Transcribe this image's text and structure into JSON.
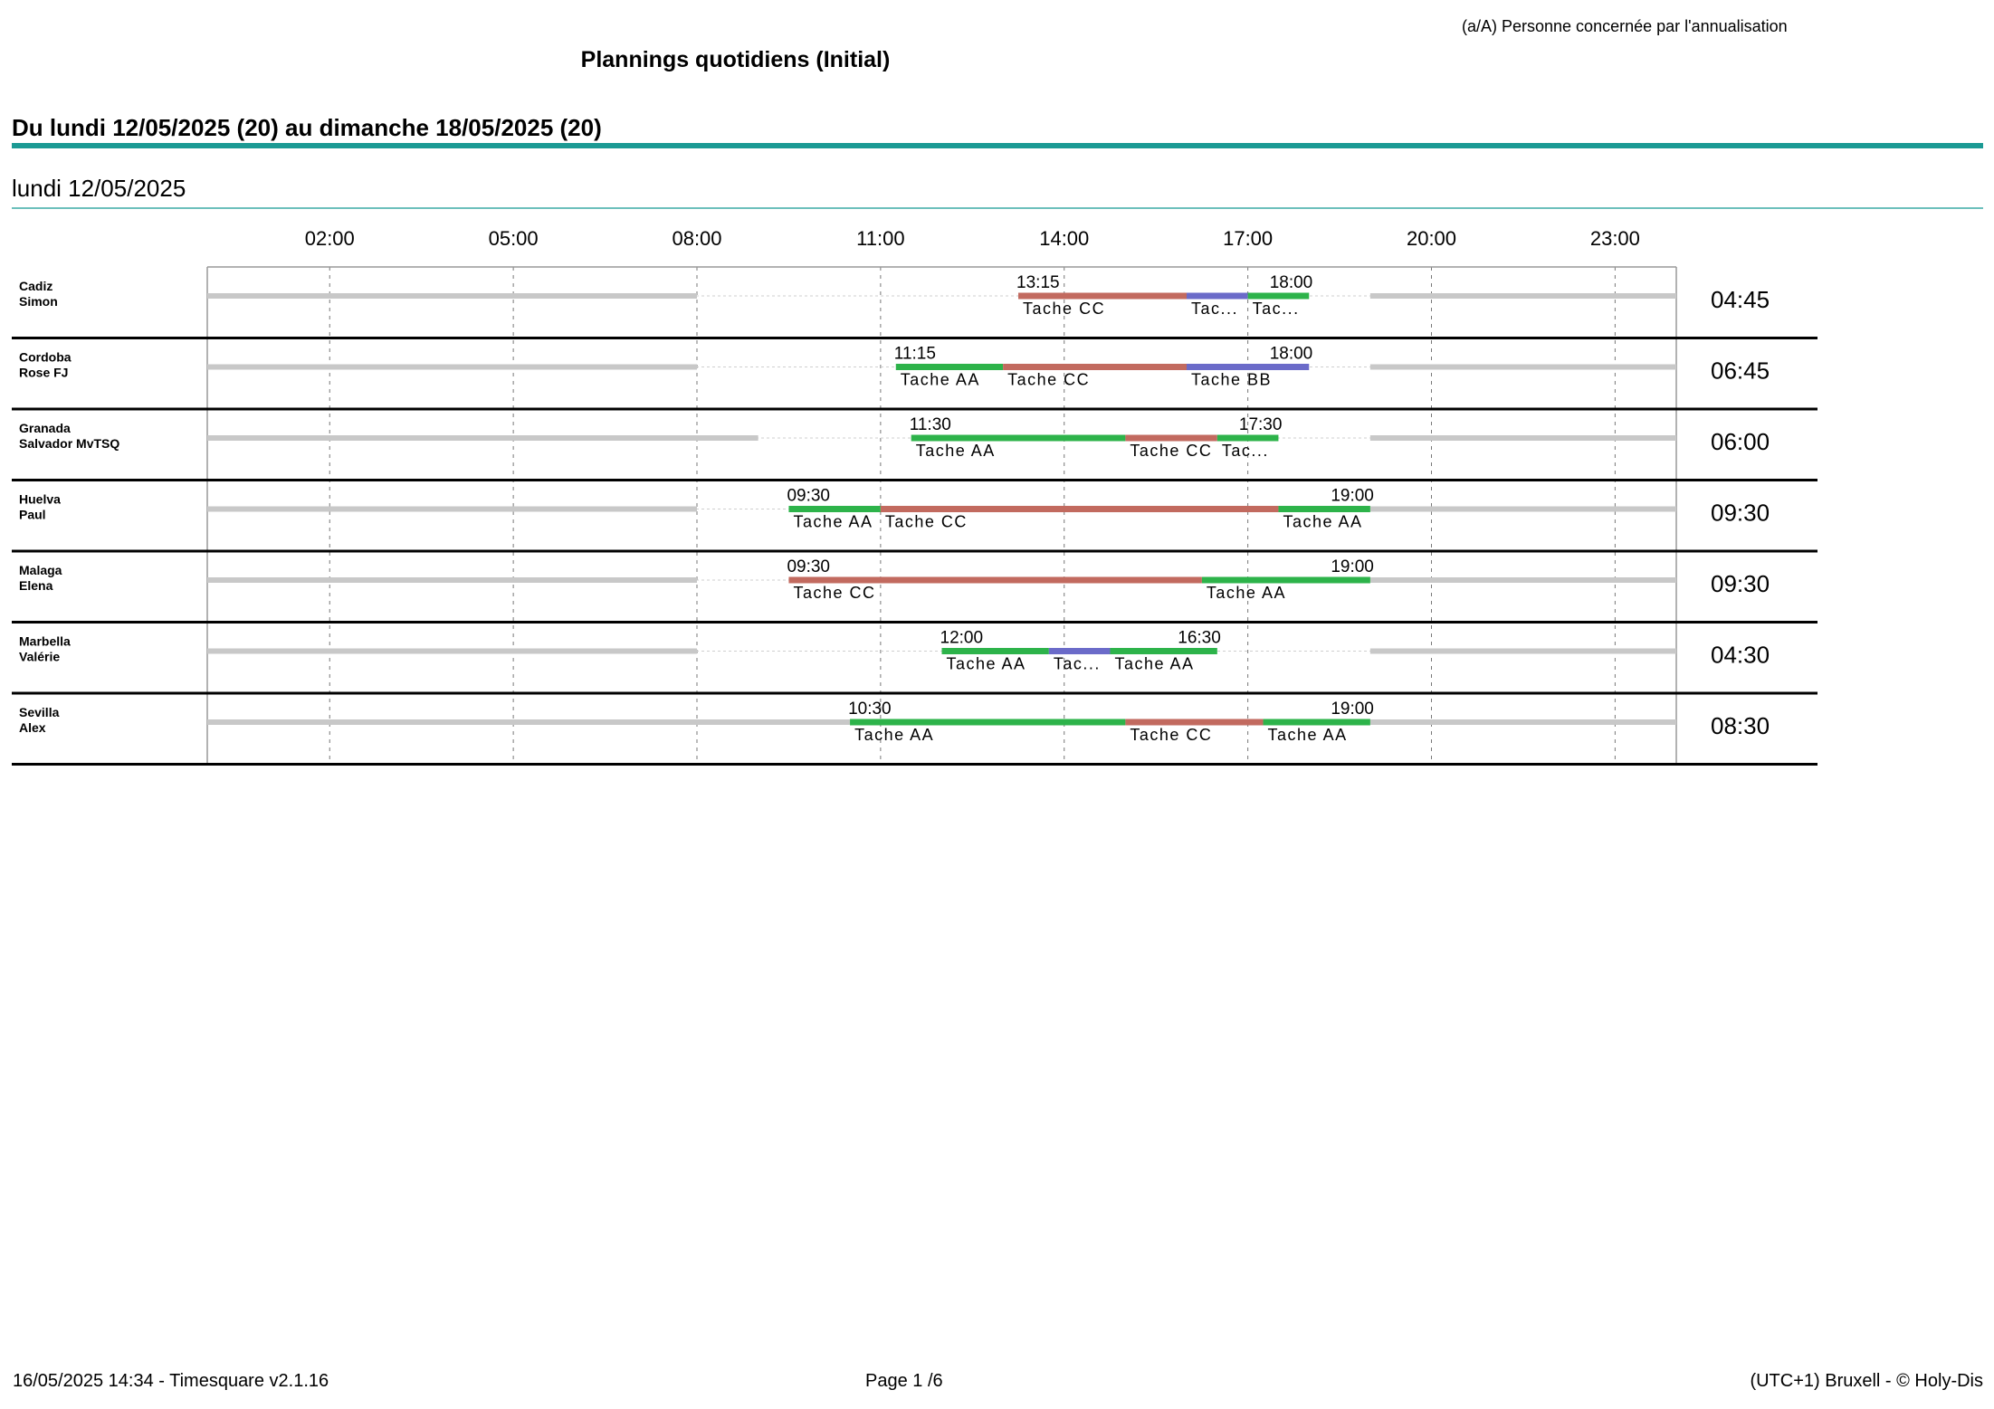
{
  "header": {
    "legend_note": "(a/A) Personne concernée par l'annualisation",
    "title": "Plannings quotidiens (Initial)",
    "week": "Du lundi 12/05/2025 (20) au dimanche 18/05/2025 (20)",
    "day": "lundi 12/05/2025"
  },
  "colors": {
    "accent_rule": "#1b9a94",
    "day_rule": "#6cc0bc",
    "off_bar": "#c8c8c8",
    "Tache AA": "#2db34a",
    "Tache CC": "#c26a5f",
    "Tache BB": "#6b6bc9"
  },
  "hour_ticks": [
    "02:00",
    "05:00",
    "08:00",
    "11:00",
    "14:00",
    "17:00",
    "20:00",
    "23:00"
  ],
  "rows": [
    {
      "name_line1": "Cadiz",
      "name_line2": "Simon",
      "start_label": "13:15",
      "end_label": "18:00",
      "total": "04:45",
      "unavailable": [
        [
          0,
          8
        ],
        [
          19,
          24
        ]
      ],
      "segments": [
        {
          "start": 13.25,
          "end": 16.0,
          "task": "Tache CC",
          "label": "Tache CC"
        },
        {
          "start": 16.0,
          "end": 17.0,
          "task": "Tache BB",
          "label": "Tac..."
        },
        {
          "start": 17.0,
          "end": 18.0,
          "task": "Tache AA",
          "label": "Tac..."
        }
      ]
    },
    {
      "name_line1": "Cordoba",
      "name_line2": "Rose FJ",
      "start_label": "11:15",
      "end_label": "18:00",
      "total": "06:45",
      "unavailable": [
        [
          0,
          8
        ],
        [
          19,
          24
        ]
      ],
      "segments": [
        {
          "start": 11.25,
          "end": 13.0,
          "task": "Tache AA",
          "label": "Tache AA"
        },
        {
          "start": 13.0,
          "end": 16.0,
          "task": "Tache CC",
          "label": "Tache CC"
        },
        {
          "start": 16.0,
          "end": 18.0,
          "task": "Tache BB",
          "label": "Tache BB"
        }
      ]
    },
    {
      "name_line1": "Granada",
      "name_line2": "Salvador MvTSQ",
      "start_label": "11:30",
      "end_label": "17:30",
      "total": "06:00",
      "unavailable": [
        [
          0,
          9
        ],
        [
          19,
          24
        ]
      ],
      "segments": [
        {
          "start": 11.5,
          "end": 15.0,
          "task": "Tache AA",
          "label": "Tache AA"
        },
        {
          "start": 15.0,
          "end": 16.5,
          "task": "Tache CC",
          "label": "Tache CC"
        },
        {
          "start": 16.5,
          "end": 17.5,
          "task": "Tache AA",
          "label": "Tac..."
        }
      ]
    },
    {
      "name_line1": "Huelva",
      "name_line2": "Paul",
      "start_label": "09:30",
      "end_label": "19:00",
      "total": "09:30",
      "unavailable": [
        [
          0,
          8
        ],
        [
          19,
          24
        ]
      ],
      "segments": [
        {
          "start": 9.5,
          "end": 11.0,
          "task": "Tache AA",
          "label": "Tache AA"
        },
        {
          "start": 11.0,
          "end": 17.5,
          "task": "Tache CC",
          "label": "Tache CC"
        },
        {
          "start": 17.5,
          "end": 19.0,
          "task": "Tache AA",
          "label": "Tache AA"
        }
      ]
    },
    {
      "name_line1": "Malaga",
      "name_line2": "Elena",
      "start_label": "09:30",
      "end_label": "19:00",
      "total": "09:30",
      "unavailable": [
        [
          0,
          8
        ],
        [
          19,
          24
        ]
      ],
      "segments": [
        {
          "start": 9.5,
          "end": 16.25,
          "task": "Tache CC",
          "label": "Tache CC"
        },
        {
          "start": 16.25,
          "end": 19.0,
          "task": "Tache AA",
          "label": "Tache AA"
        }
      ]
    },
    {
      "name_line1": "Marbella",
      "name_line2": "Valérie",
      "start_label": "12:00",
      "end_label": "16:30",
      "total": "04:30",
      "unavailable": [
        [
          0,
          8
        ],
        [
          19,
          24
        ]
      ],
      "segments": [
        {
          "start": 12.0,
          "end": 13.75,
          "task": "Tache AA",
          "label": "Tache AA"
        },
        {
          "start": 13.75,
          "end": 14.75,
          "task": "Tache BB",
          "label": "Tac..."
        },
        {
          "start": 14.75,
          "end": 16.5,
          "task": "Tache AA",
          "label": "Tache AA"
        }
      ]
    },
    {
      "name_line1": "Sevilla",
      "name_line2": "Alex",
      "start_label": "10:30",
      "end_label": "19:00",
      "total": "08:30",
      "unavailable": [
        [
          0,
          10.5
        ],
        [
          19,
          24
        ]
      ],
      "segments": [
        {
          "start": 10.5,
          "end": 15.0,
          "task": "Tache AA",
          "label": "Tache AA"
        },
        {
          "start": 15.0,
          "end": 17.25,
          "task": "Tache CC",
          "label": "Tache CC"
        },
        {
          "start": 17.25,
          "end": 19.0,
          "task": "Tache AA",
          "label": "Tache AA"
        }
      ]
    }
  ],
  "footer": {
    "left": "16/05/2025 14:34 - Timesquare v2.1.16",
    "center": "Page 1 /6",
    "right": "(UTC+1) Bruxell - © Holy-Dis"
  }
}
